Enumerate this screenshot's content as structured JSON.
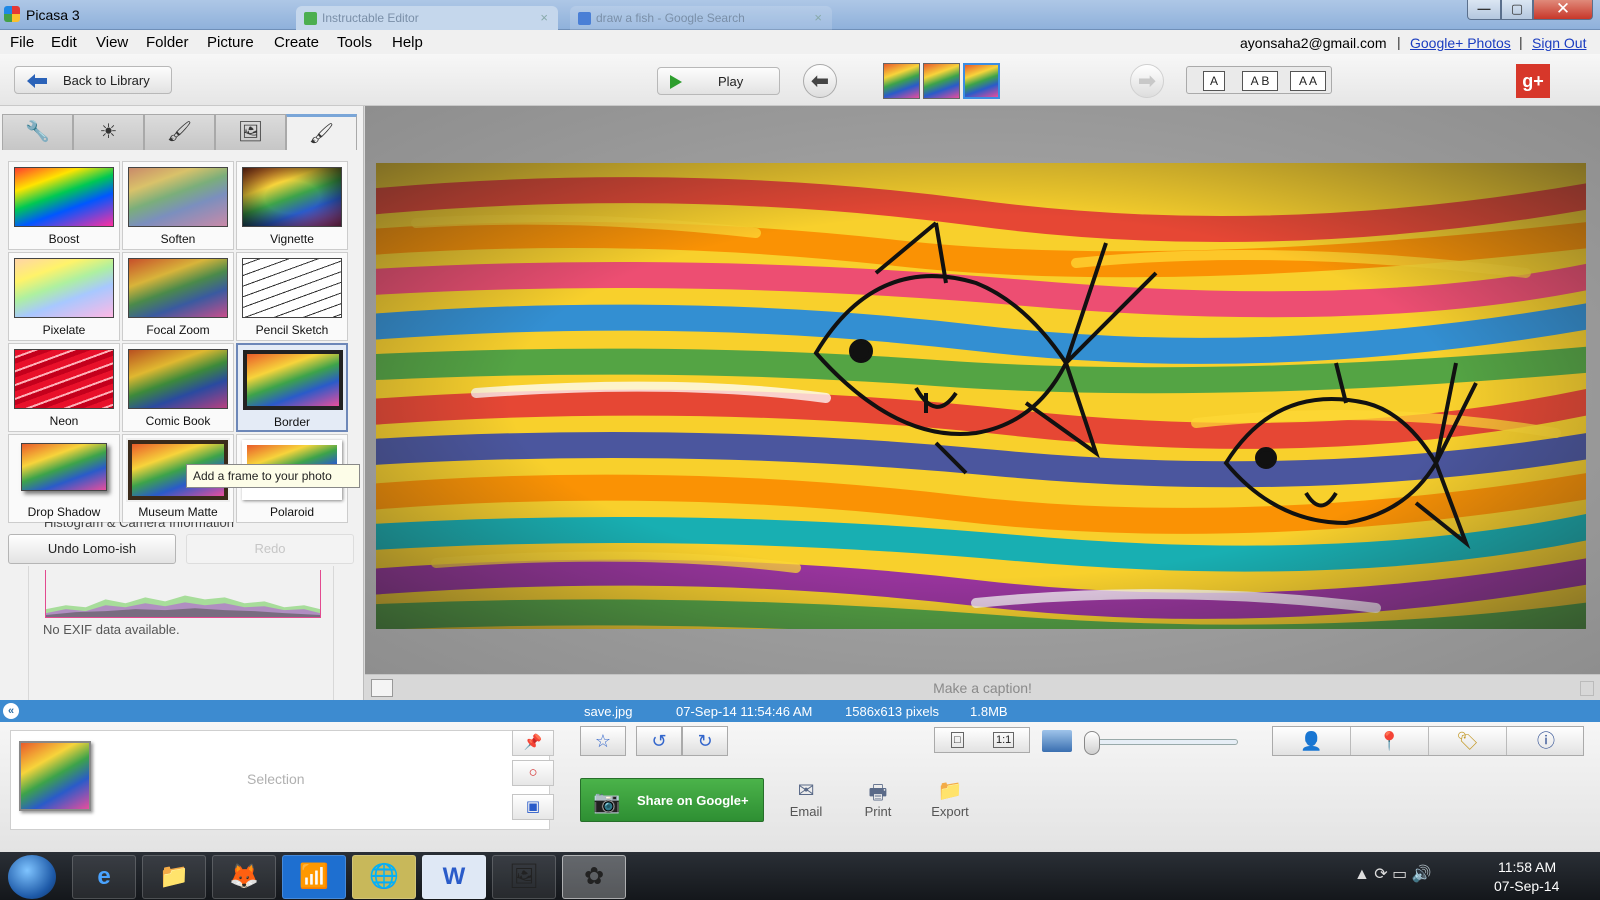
{
  "app": {
    "title": "Picasa 3",
    "bg_tabs": [
      {
        "label": "Instructable Editor",
        "close": "×"
      },
      {
        "label": "draw a fish - Google Search",
        "close": "×"
      }
    ],
    "window_buttons": {
      "min": "—",
      "max": "▢",
      "close": "✕"
    }
  },
  "menu": {
    "items": [
      "File",
      "Edit",
      "View",
      "Folder",
      "Picture",
      "Create",
      "Tools",
      "Help"
    ],
    "account_email": "ayonsaha2@gmail.com",
    "links": [
      "Google+ Photos",
      "Sign Out"
    ],
    "separator": "|"
  },
  "toolbar": {
    "back_label": "Back to Library",
    "play_label": "Play",
    "prev_icon": "⬅",
    "next_icon": "➡",
    "text_sizes": [
      "A",
      "A B",
      "A A"
    ],
    "gplus_label": "g+"
  },
  "edit_tabs": [
    {
      "name": "tab-basic-fixes",
      "icon": "wrench-icon",
      "glyph": "🔧"
    },
    {
      "name": "tab-tuning",
      "icon": "sun-icon",
      "glyph": "☀"
    },
    {
      "name": "tab-effects",
      "icon": "brush-icon",
      "glyph": "🖌"
    },
    {
      "name": "tab-effects-2",
      "icon": "image-brush-icon",
      "glyph": "🖼"
    },
    {
      "name": "tab-effects-3",
      "icon": "image-brush-blue-icon",
      "glyph": "🖌"
    }
  ],
  "effects": [
    {
      "label": "Boost"
    },
    {
      "label": "Soften"
    },
    {
      "label": "Vignette"
    },
    {
      "label": "Pixelate"
    },
    {
      "label": "Focal Zoom"
    },
    {
      "label": "Pencil Sketch"
    },
    {
      "label": "Neon"
    },
    {
      "label": "Comic Book"
    },
    {
      "label": "Border"
    },
    {
      "label": "Drop Shadow"
    },
    {
      "label": "Museum Matte"
    },
    {
      "label": "Polaroid"
    }
  ],
  "tooltip": "Add a frame to your photo",
  "histogram": {
    "title": "Histogram & Camera Information",
    "undo_label": "Undo Lomo-ish",
    "redo_label": "Redo",
    "exif_text": "No EXIF data available."
  },
  "caption": {
    "placeholder": "Make a caption!"
  },
  "status": {
    "collapse_icon": "«",
    "filename": "save.jpg",
    "datetime": "07-Sep-14 11:54:46 AM",
    "dimensions": "1586x613 pixels",
    "filesize": "1.8MB"
  },
  "bottom": {
    "selection_label": "Selection",
    "tray_tools": [
      "📌",
      "○",
      "▣"
    ],
    "star_icon": "☆",
    "rotate_left": "↺",
    "rotate_right": "↻",
    "zoom_fit": "□",
    "zoom_1to1": "1:1",
    "share_label": "Share on Google+",
    "share_icon": "📷",
    "actions": [
      {
        "label": "Email",
        "glyph": "✉"
      },
      {
        "label": "Print",
        "glyph": "🖶"
      },
      {
        "label": "Export",
        "glyph": "📁"
      }
    ],
    "right_tools": [
      "👤",
      "📍",
      "🏷",
      "ⓘ"
    ]
  },
  "taskbar": {
    "apps": [
      {
        "name": "taskbar-ie",
        "glyph": "e"
      },
      {
        "name": "taskbar-explorer",
        "glyph": "📁"
      },
      {
        "name": "taskbar-firefox",
        "glyph": "🦊"
      },
      {
        "name": "taskbar-wifi",
        "glyph": "📶"
      },
      {
        "name": "taskbar-globe",
        "glyph": "🌐"
      },
      {
        "name": "taskbar-word",
        "glyph": "W"
      },
      {
        "name": "taskbar-photos",
        "glyph": "🖼"
      },
      {
        "name": "taskbar-picasa",
        "glyph": "✿"
      }
    ],
    "tray_icons": "▲  ⟳  ▭  🔊",
    "time": "11:58 AM",
    "date": "07-Sep-14"
  }
}
